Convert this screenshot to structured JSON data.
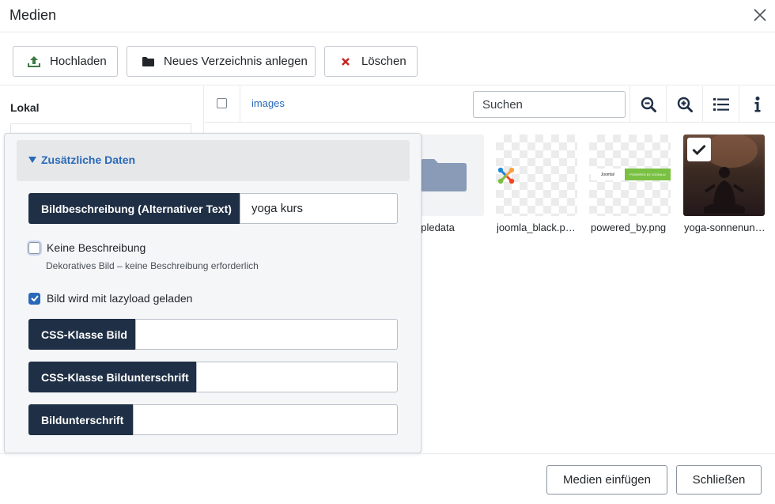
{
  "header": {
    "title": "Medien"
  },
  "toolbar": {
    "upload_label": "Hochladen",
    "new_folder_label": "Neues Verzeichnis anlegen",
    "delete_label": "Löschen"
  },
  "sidebar": {
    "title": "Lokal"
  },
  "browser": {
    "breadcrumb": "images",
    "search_placeholder": "Suchen"
  },
  "items": [
    {
      "name": "sampledata",
      "visible_name": "npledata",
      "type": "folder"
    },
    {
      "name": "joomla_black.p…",
      "type": "image"
    },
    {
      "name": "powered_by.png",
      "type": "image",
      "banner_left": "Joomla!",
      "banner_right": "POWERED BY JOOMLA!"
    },
    {
      "name": "yoga-sonnenun…",
      "type": "image",
      "selected": true
    }
  ],
  "panel": {
    "title": "Zusätzliche Daten",
    "alt_label": "Bildbeschreibung (Alternativer Text)",
    "alt_value": "yoga kurs",
    "no_desc_label": "Keine Beschreibung",
    "no_desc_hint": "Dekoratives Bild – keine Beschreibung erforderlich",
    "no_desc_checked": false,
    "lazy_label": "Bild wird mit lazyload geladen",
    "lazy_checked": true,
    "css_image_label": "CSS-Klasse Bild",
    "css_image_value": "",
    "css_caption_label": "CSS-Klasse Bildunterschrift",
    "css_caption_value": "",
    "caption_label": "Bildunterschrift",
    "caption_value": ""
  },
  "footer": {
    "insert_label": "Medien einfügen",
    "close_label": "Schließen"
  },
  "colors": {
    "primary": "#2a69b8",
    "dark_label": "#1f2f45",
    "upload_icon": "#3c7a45",
    "delete_icon": "#c52827"
  }
}
